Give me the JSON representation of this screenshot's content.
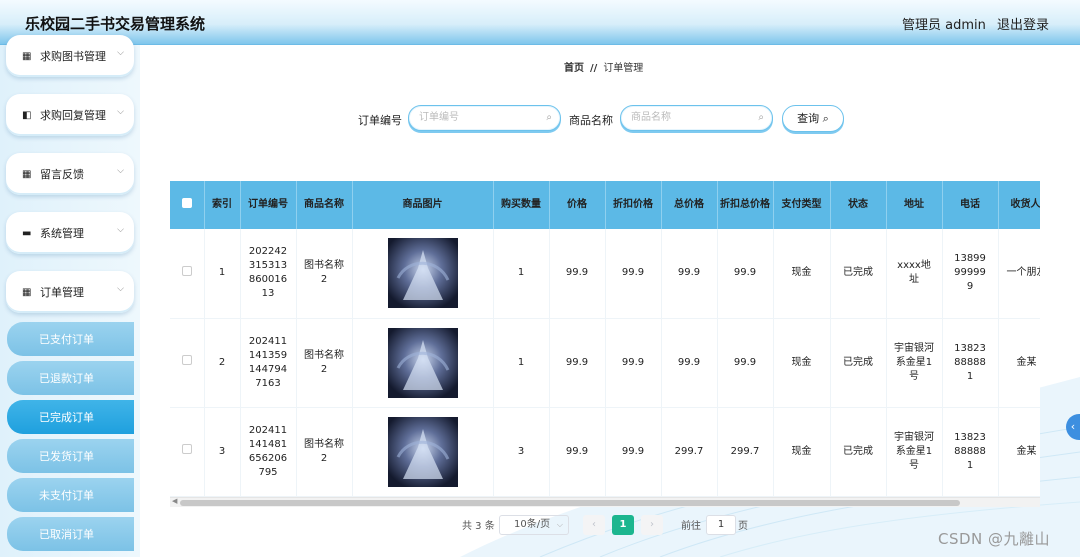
{
  "header": {
    "title": "乐校园二手书交易管理系统",
    "admin": "管理员 admin",
    "logout": "退出登录"
  },
  "sidebar": {
    "menus": [
      {
        "label": "求购图书管理",
        "icon": "grid-icon"
      },
      {
        "label": "求购回复管理",
        "icon": "reply-icon"
      },
      {
        "label": "留言反馈",
        "icon": "grid-icon"
      },
      {
        "label": "系统管理",
        "icon": "monitor-icon"
      },
      {
        "label": "订单管理",
        "icon": "grid-icon"
      }
    ],
    "subitems": [
      "已支付订单",
      "已退款订单",
      "已完成订单",
      "已发货订单",
      "未支付订单",
      "已取消订单"
    ],
    "active_subitem": "已完成订单"
  },
  "breadcrumb": {
    "home": "首页",
    "sep": "//",
    "current": "订单管理"
  },
  "filters": {
    "order_label": "订单编号",
    "order_placeholder": "订单编号",
    "name_label": "商品名称",
    "name_placeholder": "商品名称",
    "query_label": "查询"
  },
  "table": {
    "headers": [
      "索引",
      "订单编号",
      "商品名称",
      "商品图片",
      "购买数量",
      "价格",
      "折扣价格",
      "总价格",
      "折扣总价格",
      "支付类型",
      "状态",
      "地址",
      "电话",
      "收货人"
    ],
    "rows": [
      {
        "index": "1",
        "order_no": "20224231531386001613",
        "name": "图书名称2",
        "qty": "1",
        "price": "99.9",
        "discount_price": "99.9",
        "total": "99.9",
        "discount_total": "99.9",
        "pay_type": "现金",
        "status": "已完成",
        "address": "xxxx地址",
        "phone": "13899999999",
        "receiver": "一个朋友"
      },
      {
        "index": "2",
        "order_no": "2024111413591447947163",
        "name": "图书名称2",
        "qty": "1",
        "price": "99.9",
        "discount_price": "99.9",
        "total": "99.9",
        "discount_total": "99.9",
        "pay_type": "现金",
        "status": "已完成",
        "address": "宇宙银河系金星1号",
        "phone": "13823888881",
        "receiver": "金某"
      },
      {
        "index": "3",
        "order_no": "20241114148165620679​5",
        "name": "图书名称2",
        "qty": "3",
        "price": "99.9",
        "discount_price": "99.9",
        "total": "299.7",
        "discount_total": "299.7",
        "pay_type": "现金",
        "status": "已完成",
        "address": "宇宙银河系金星1号",
        "phone": "13823888881",
        "receiver": "金某"
      }
    ]
  },
  "pagination": {
    "total": "共 3 条",
    "page_size": "10条/页",
    "prev": "‹",
    "current": "1",
    "next": "›",
    "goto": "前往",
    "goto_value": "1",
    "page_suffix": "页"
  },
  "watermark": "CSDN @九離山",
  "colors": {
    "accent": "#5cb9e6",
    "active_sub": "#1fa0de",
    "page_active": "#1cb68f"
  }
}
